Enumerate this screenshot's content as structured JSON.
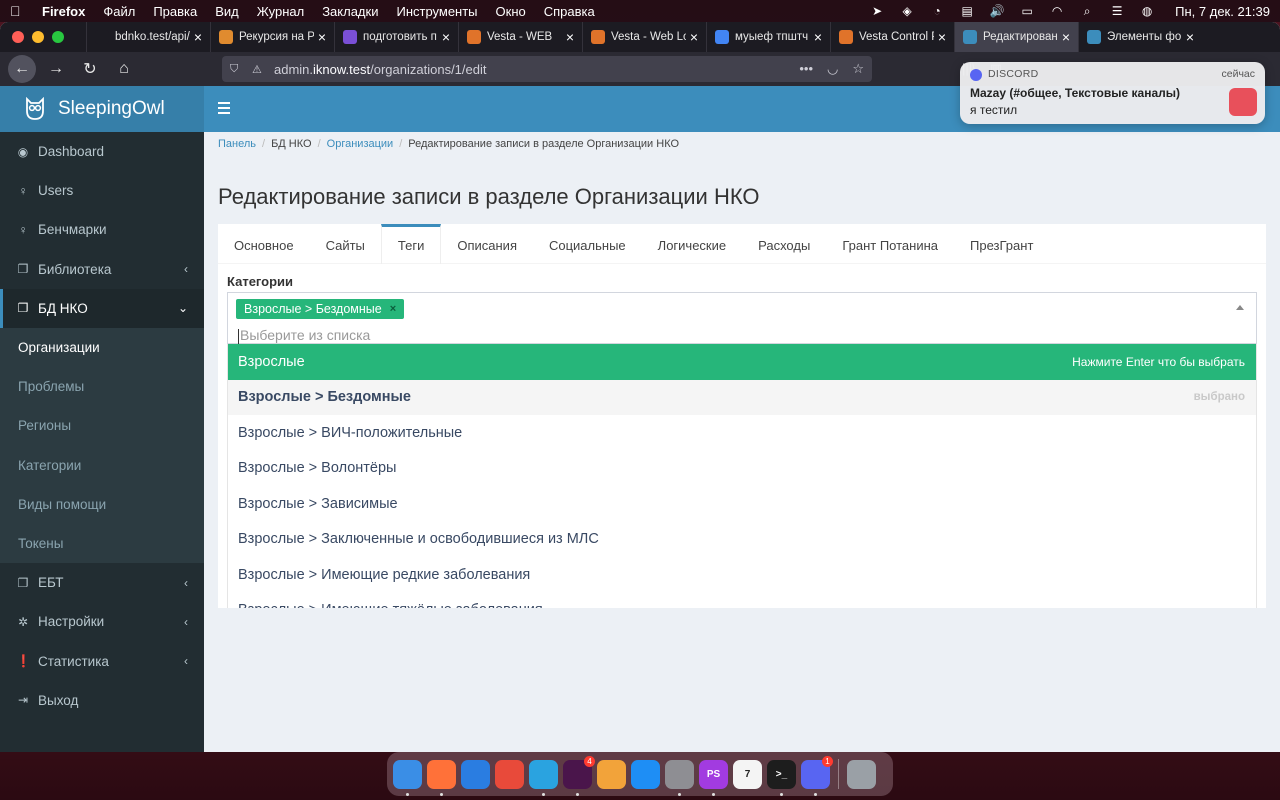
{
  "menubar": {
    "app": "Firefox",
    "items": [
      "Файл",
      "Правка",
      "Вид",
      "Журнал",
      "Закладки",
      "Инструменты",
      "Окно",
      "Справка"
    ],
    "clock": "Пн, 7 дек.  21:39"
  },
  "browser": {
    "tabs": [
      {
        "label": "bdnko.test/api/test",
        "icon": "page-icon",
        "color": "#1c1b22"
      },
      {
        "label": "Рекурсия на Р",
        "icon": "flower-icon",
        "color": "#e08b2f"
      },
      {
        "label": "подготовить п",
        "icon": "tracker-icon",
        "color": "#7a4fd6"
      },
      {
        "label": "Vesta - WEB",
        "icon": "vesta-icon",
        "color": "#e0732a"
      },
      {
        "label": "Vesta - Web Lo",
        "icon": "vesta-icon",
        "color": "#e0732a"
      },
      {
        "label": "муыеф тпштч",
        "icon": "google-icon",
        "color": "#4285f4"
      },
      {
        "label": "Vesta Control P",
        "icon": "vesta-icon",
        "color": "#e0732a"
      },
      {
        "label": "Редактирование",
        "icon": "owl-icon",
        "color": "#3c8dbc"
      },
      {
        "label": "Элементы форм",
        "icon": "owl-icon",
        "color": "#3c8dbc"
      }
    ],
    "url_prefix": "admin.",
    "url_host": "iknow.test",
    "url_path": "/organizations/1/edit"
  },
  "sidebar": {
    "brand": "SleepingOwl",
    "items": [
      {
        "label": "Dashboard",
        "icon": "dashboard-icon",
        "glyph": "◉"
      },
      {
        "label": "Users",
        "icon": "bulb-icon",
        "glyph": "♀"
      },
      {
        "label": "Бенчмарки",
        "icon": "bulb-icon",
        "glyph": "♀"
      },
      {
        "label": "Библиотека",
        "icon": "copy-icon",
        "glyph": "❐",
        "chevron": "‹"
      },
      {
        "label": "БД НКО",
        "icon": "copy-icon",
        "glyph": "❐",
        "chevron": "⌄"
      }
    ],
    "subitems": [
      "Организации",
      "Проблемы",
      "Регионы",
      "Категории",
      "Виды помощи",
      "Токены"
    ],
    "items_after": [
      {
        "label": "ЕБТ",
        "icon": "copy-icon",
        "glyph": "❐",
        "chevron": "‹"
      },
      {
        "label": "Настройки",
        "icon": "gear-icon",
        "glyph": "✲",
        "chevron": "‹"
      },
      {
        "label": "Статистика",
        "icon": "info-icon",
        "glyph": "❗",
        "chevron": "‹"
      },
      {
        "label": "Выход",
        "icon": "logout-icon",
        "glyph": "⇥"
      }
    ]
  },
  "breadcrumb": {
    "home": "Панель",
    "section": "БД НКО",
    "list": "Организации",
    "current": "Редактирование записи в разделе Организации НКО"
  },
  "page": {
    "title": "Редактирование записи в разделе Организации НКО",
    "tabs": [
      "Основное",
      "Сайты",
      "Теги",
      "Описания",
      "Социальные",
      "Логические",
      "Расходы",
      "Грант Потанина",
      "ПрезГрант"
    ],
    "active_tab": "Теги"
  },
  "field": {
    "label": "Категории",
    "chip": "Взрослые > Бездомные",
    "placeholder": "Выберите из списка",
    "options": [
      {
        "label": "Взрослые",
        "hint": "Нажмите Enter что бы выбрать",
        "state": "highlight"
      },
      {
        "label": "Взрослые > Бездомные",
        "hint": "выбрано",
        "state": "selected"
      },
      {
        "label": "Взрослые > ВИЧ-положительные",
        "hint": "",
        "state": ""
      },
      {
        "label": "Взрослые > Волонтёры",
        "hint": "",
        "state": ""
      },
      {
        "label": "Взрослые > Зависимые",
        "hint": "",
        "state": ""
      },
      {
        "label": "Взрослые > Заключенные и освободившиеся из МЛС",
        "hint": "",
        "state": ""
      },
      {
        "label": "Взрослые > Имеющие редкие заболевания",
        "hint": "",
        "state": ""
      },
      {
        "label": "Взрослые > Имеющие тяжёлые заболевания",
        "hint": "",
        "state": ""
      }
    ]
  },
  "notification": {
    "app": "DISCORD",
    "time": "сейчас",
    "title": "Mazay (#общее, Текстовые каналы)",
    "body": "я тестил"
  },
  "dock": [
    {
      "name": "finder-icon",
      "color": "#3a8ee6",
      "label": ""
    },
    {
      "name": "firefox-icon",
      "color": "#ff7139",
      "label": ""
    },
    {
      "name": "paw-icon",
      "color": "#2a7de1",
      "label": ""
    },
    {
      "name": "postman-icon",
      "color": "#e84a3a",
      "label": ""
    },
    {
      "name": "telegram-icon",
      "color": "#2aa3e0",
      "label": ""
    },
    {
      "name": "slack-icon",
      "color": "#4a154b",
      "label": "",
      "badge": "4"
    },
    {
      "name": "photos-icon",
      "color": "#f2a33a",
      "label": ""
    },
    {
      "name": "appstore-icon",
      "color": "#1e8ef5",
      "label": ""
    },
    {
      "name": "settings-icon",
      "color": "#8e8e93",
      "label": ""
    },
    {
      "name": "phpstorm-icon",
      "color": "#a23be0",
      "label": "PS"
    },
    {
      "name": "calendar-icon",
      "color": "#f4f4f4",
      "label": "7"
    },
    {
      "name": "terminal-icon",
      "color": "#1d1d1d",
      "label": ">_"
    },
    {
      "name": "discord-icon",
      "color": "#5865f2",
      "label": "",
      "badge": "1"
    },
    {
      "name": "trash-icon",
      "color": "#9aa0a6",
      "label": ""
    }
  ]
}
